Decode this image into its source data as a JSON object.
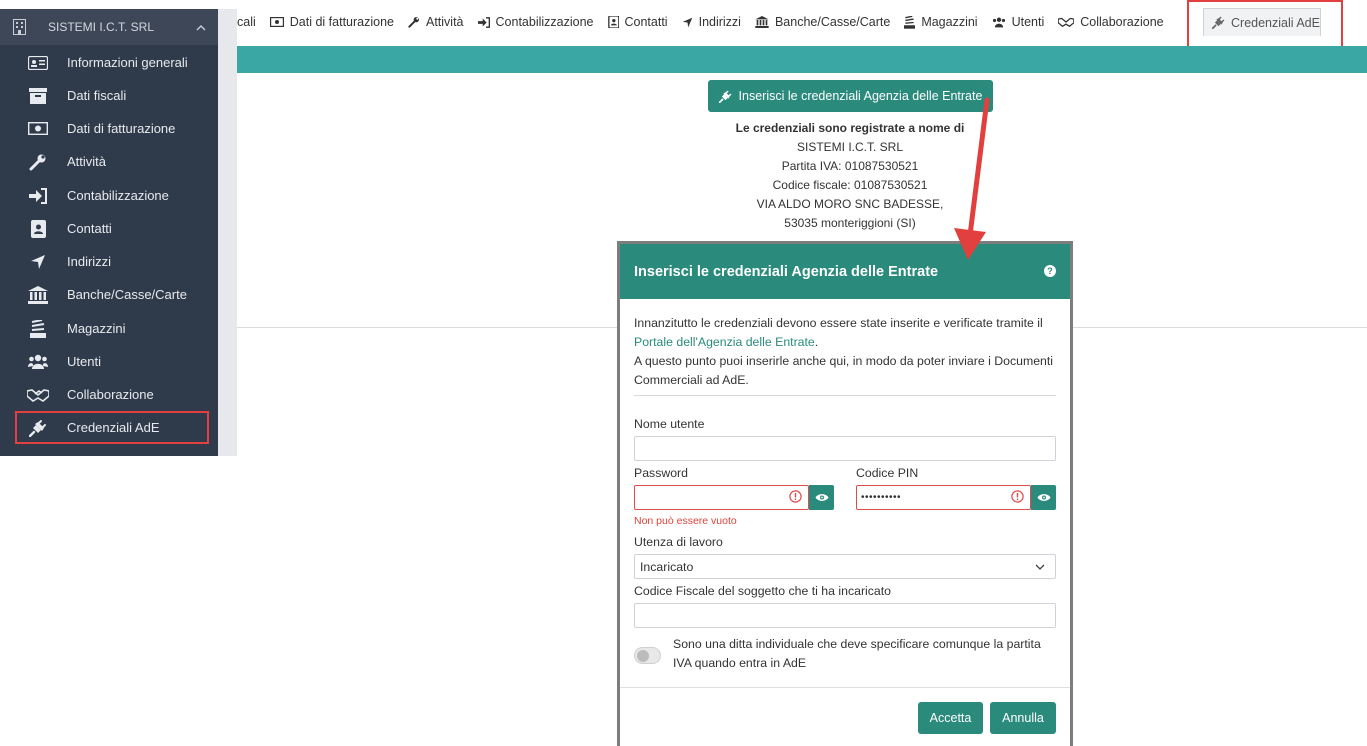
{
  "sidebar": {
    "company": "SISTEMI I.C.T. SRL",
    "items": [
      {
        "label": "Informazioni generali",
        "icon": "id-card-icon"
      },
      {
        "label": "Dati fiscali",
        "icon": "archive-icon"
      },
      {
        "label": "Dati di fatturazione",
        "icon": "banknote-icon"
      },
      {
        "label": "Attività",
        "icon": "wrench-icon"
      },
      {
        "label": "Contabilizzazione",
        "icon": "sign-in-icon"
      },
      {
        "label": "Contatti",
        "icon": "contact-book-icon"
      },
      {
        "label": "Indirizzi",
        "icon": "location-arrow-icon"
      },
      {
        "label": "Banche/Casse/Carte",
        "icon": "bank-icon"
      },
      {
        "label": "Magazzini",
        "icon": "stack-icon"
      },
      {
        "label": "Utenti",
        "icon": "users-icon"
      },
      {
        "label": "Collaborazione",
        "icon": "handshake-icon"
      },
      {
        "label": "Credenziali AdE",
        "icon": "plug-icon"
      }
    ]
  },
  "tabs": {
    "items": [
      {
        "label": "cali"
      },
      {
        "label": "Dati di fatturazione"
      },
      {
        "label": "Attività"
      },
      {
        "label": "Contabilizzazione"
      },
      {
        "label": "Contatti"
      },
      {
        "label": "Indirizzi"
      },
      {
        "label": "Banche/Casse/Carte"
      },
      {
        "label": "Magazzini"
      },
      {
        "label": "Utenti"
      },
      {
        "label": "Collaborazione"
      }
    ],
    "active": "Credenziali AdE"
  },
  "main": {
    "button_label": "Inserisci le credenziali Agenzia delle Entrate",
    "registered_title": "Le credenziali sono registrate a nome di",
    "name": "SISTEMI I.C.T. SRL",
    "piva": "Partita IVA: 01087530521",
    "cf": "Codice fiscale: 01087530521",
    "address1": "VIA ALDO MORO SNC BADESSE,",
    "address2": "53035 monteriggioni (SI)"
  },
  "modal": {
    "title": "Inserisci le credenziali Agenzia delle Entrate",
    "help": "?",
    "intro_1": "Innanzitutto le credenziali devono essere state inserite e verificate tramite il ",
    "intro_link": "Portale dell'Agenzia delle Entrate",
    "intro_2": ".",
    "intro_3": "A questo punto puoi inserirle anche qui, in modo da poter inviare i Documenti Commerciali ad AdE.",
    "username_label": "Nome utente",
    "username_value": "",
    "password_label": "Password",
    "password_value": "",
    "pin_label": "Codice PIN",
    "pin_value": "••••••••••",
    "error_msg": "Non può essere vuoto",
    "utenza_label": "Utenza di lavoro",
    "utenza_value": "Incaricato",
    "cf_label": "Codice Fiscale del soggetto che ti ha incaricato",
    "cf_value": "",
    "toggle_text": "Sono una ditta individuale che deve specificare comunque la partita IVA quando entra in AdE",
    "toggle_on": false,
    "accept_label": "Accetta",
    "cancel_label": "Annulla"
  },
  "colors": {
    "teal": "#2a8a7c",
    "teal_bar": "#3aa7a5",
    "sidebar_bg": "#2f3a4b",
    "highlight_red": "#e23f3f",
    "error_red": "#d9443a"
  }
}
